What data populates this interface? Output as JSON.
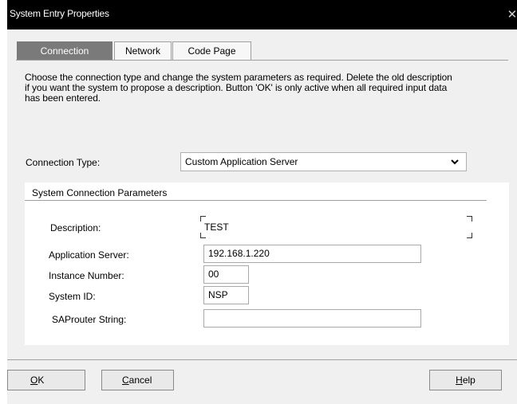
{
  "window": {
    "title": "System Entry Properties",
    "close_glyph": "✕"
  },
  "tabs": [
    {
      "label": "Connection",
      "active": true
    },
    {
      "label": "Network",
      "active": false
    },
    {
      "label": "Code Page",
      "active": false
    }
  ],
  "description_lines": [
    "Choose the connection type and change the system parameters as required. Delete the old description",
    "if you want the system to propose a description. Button 'OK' is only active when all required input data",
    "has been entered."
  ],
  "connection_type": {
    "label": "Connection Type:",
    "value": "Custom Application Server",
    "chevron": "⌵"
  },
  "parameters": {
    "group_title": "System Connection Parameters",
    "fields": [
      {
        "label": "Description:",
        "value": "TEST"
      },
      {
        "label": "Application Server:",
        "value": "192.168.1.220"
      },
      {
        "label": "Instance Number:",
        "value": "00"
      },
      {
        "label": "System ID:",
        "value": "NSP"
      },
      {
        "label": "SAProuter String:",
        "value": ""
      }
    ]
  },
  "buttons": {
    "ok_mnemonic": "O",
    "ok_rest": "K",
    "cancel_mnemonic": "C",
    "cancel_rest": "ancel",
    "help_mnemonic": "H",
    "help_rest": "elp"
  },
  "colors": {
    "title_bar": "#000000",
    "dialog_bg": "#f0f0f0",
    "active_tab": "#7a7a7a"
  }
}
